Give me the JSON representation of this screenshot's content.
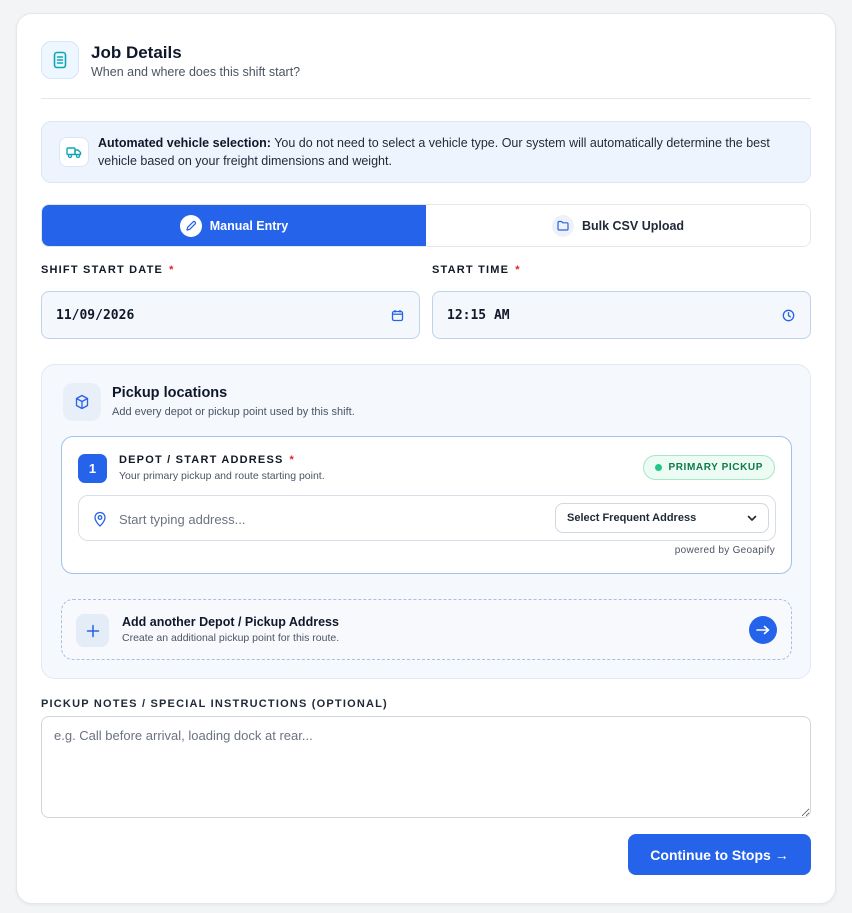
{
  "header": {
    "title": "Job Details",
    "subtitle": "When and where does this shift start?",
    "icon": "document-icon"
  },
  "banner": {
    "bold": "Automated vehicle selection:",
    "text": " You do not need to select a vehicle type. Our system will automatically determine the best vehicle based on your freight dimensions and weight.",
    "icon": "truck-icon"
  },
  "tabs": [
    {
      "label": "Manual Entry",
      "icon": "pencil-icon",
      "active": true
    },
    {
      "label": "Bulk CSV Upload",
      "icon": "folder-icon",
      "active": false
    }
  ],
  "shift": {
    "date_label": "SHIFT START DATE",
    "date_value": "11/09/2026",
    "time_label": "START TIME",
    "time_value": "12:15 AM",
    "required_mark": "*"
  },
  "pickup": {
    "title": "Pickup locations",
    "subtitle": "Add every depot or pickup point used by this shift.",
    "depot": {
      "number": "1",
      "title": "DEPOT / START ADDRESS",
      "subtitle": "Your primary pickup and route starting point.",
      "badge": "PRIMARY PICKUP",
      "address_placeholder": "Start typing address...",
      "frequent_select": "Select Frequent Address",
      "powered_by": "powered by Geoapify"
    },
    "add_another": {
      "title": "Add another Depot / Pickup Address",
      "subtitle": "Create an additional pickup point for this route.",
      "arrow": "→"
    }
  },
  "notes": {
    "label": "PICKUP NOTES / SPECIAL INSTRUCTIONS (OPTIONAL)",
    "placeholder": "e.g. Call before arrival, loading dock at rear..."
  },
  "cta": {
    "label": "Continue to Stops →"
  },
  "colors": {
    "accent": "#2563eb",
    "success": "#0f7a4a",
    "required": "#dc2626"
  }
}
